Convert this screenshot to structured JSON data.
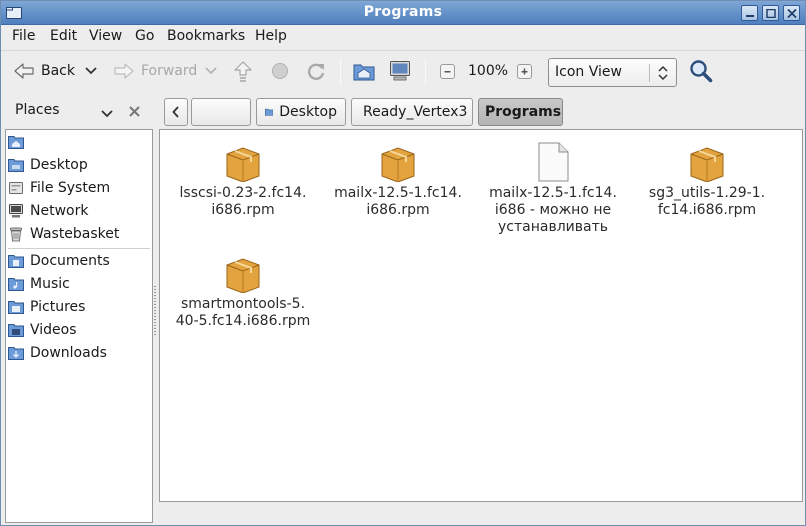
{
  "window": {
    "title": "Programs"
  },
  "menu": [
    "File",
    "Edit",
    "View",
    "Go",
    "Bookmarks",
    "Help"
  ],
  "toolbar": {
    "back_label": "Back",
    "forward_label": "Forward",
    "zoom_level": "100%",
    "view_mode": "Icon View"
  },
  "places": {
    "header": "Places",
    "items": [
      {
        "label": "",
        "icon": "home-folder-icon"
      },
      {
        "label": "Desktop",
        "icon": "folder-icon"
      },
      {
        "label": "File System",
        "icon": "drive-icon"
      },
      {
        "label": "Network",
        "icon": "network-icon"
      },
      {
        "label": "Wastebasket",
        "icon": "trash-icon"
      },
      {
        "label": "Documents",
        "icon": "folder-icon"
      },
      {
        "label": "Music",
        "icon": "folder-icon"
      },
      {
        "label": "Pictures",
        "icon": "folder-icon"
      },
      {
        "label": "Videos",
        "icon": "folder-icon"
      },
      {
        "label": "Downloads",
        "icon": "folder-icon"
      }
    ]
  },
  "pathbar": {
    "segments": [
      "",
      "Desktop",
      "Ready_Vertex3",
      "Programs"
    ],
    "active": "Programs"
  },
  "files": [
    {
      "name": "lsscsi-0.23-2.fc14.\ni686.rpm",
      "icon": "package-icon"
    },
    {
      "name": "mailx-12.5-1.fc14.\ni686.rpm",
      "icon": "package-icon"
    },
    {
      "name": "mailx-12.5-1.fc14.\ni686 - можно не\nустанавливать",
      "icon": "document-icon"
    },
    {
      "name": "sg3_utils-1.29-1.\nfc14.i686.rpm",
      "icon": "package-icon"
    },
    {
      "name": "smartmontools-5.\n40-5.fc14.i686.rpm",
      "icon": "package-icon"
    }
  ],
  "colors": {
    "titlebar": "#5b89c6",
    "folder": "#5d8fcf",
    "package": "#e3a33e"
  }
}
